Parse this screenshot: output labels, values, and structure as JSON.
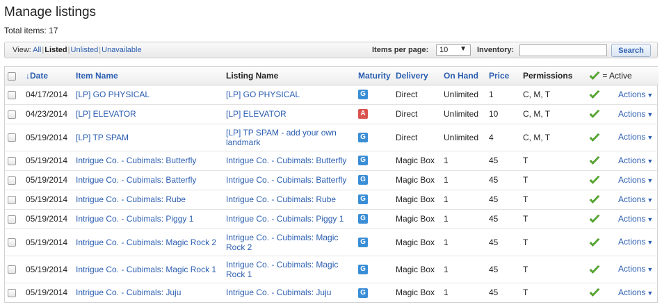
{
  "page": {
    "title": "Manage listings",
    "total_items": "Total items: 17"
  },
  "toolbar": {
    "view_label": "View:",
    "view_options": [
      "All",
      "Listed",
      "Unlisted",
      "Unavailable"
    ],
    "view_active": "Listed",
    "items_per_page_label": "Items per page:",
    "items_per_page_value": "10",
    "inventory_label": "Inventory:",
    "inventory_value": "",
    "search_label": "Search"
  },
  "colors": {
    "link": "#2a5db0",
    "badge_general": "#3a8ed6",
    "badge_adult": "#d9534f",
    "check_green": "#5cb030"
  },
  "table": {
    "headers": {
      "date": "↓Date",
      "item_name": "Item Name",
      "listing_name": "Listing Name",
      "maturity": "Maturity",
      "delivery": "Delivery",
      "on_hand": "On Hand",
      "price": "Price",
      "permissions": "Permissions",
      "active": "= Active"
    },
    "rows": [
      {
        "date": "04/17/2014",
        "item": "[LP] GO PHYSICAL",
        "listing": "[LP] GO PHYSICAL",
        "maturity": "G",
        "delivery": "Direct",
        "on_hand": "Unlimited",
        "price": "1",
        "permissions": "C, M, T",
        "actions": "Actions"
      },
      {
        "date": "04/23/2014",
        "item": "[LP] ELEVATOR",
        "listing": "[LP] ELEVATOR",
        "maturity": "A",
        "delivery": "Direct",
        "on_hand": "Unlimited",
        "price": "10",
        "permissions": "C, M, T",
        "actions": "Actions"
      },
      {
        "date": "05/19/2014",
        "item": "[LP] TP SPAM",
        "listing": "[LP] TP SPAM - add your own landmark",
        "maturity": "G",
        "delivery": "Direct",
        "on_hand": "Unlimited",
        "price": "4",
        "permissions": "C, M, T",
        "actions": "Actions"
      },
      {
        "date": "05/19/2014",
        "item": "Intrigue Co. - Cubimals: Butterfly",
        "listing": "Intrigue Co. - Cubimals: Butterfly",
        "maturity": "G",
        "delivery": "Magic Box",
        "on_hand": "1",
        "price": "45",
        "permissions": "T",
        "actions": "Actions"
      },
      {
        "date": "05/19/2014",
        "item": "Intrigue Co. - Cubimals: Batterfly",
        "listing": "Intrigue Co. - Cubimals: Batterfly",
        "maturity": "G",
        "delivery": "Magic Box",
        "on_hand": "1",
        "price": "45",
        "permissions": "T",
        "actions": "Actions"
      },
      {
        "date": "05/19/2014",
        "item": "Intrigue Co. - Cubimals: Rube",
        "listing": "Intrigue Co. - Cubimals: Rube",
        "maturity": "G",
        "delivery": "Magic Box",
        "on_hand": "1",
        "price": "45",
        "permissions": "T",
        "actions": "Actions"
      },
      {
        "date": "05/19/2014",
        "item": "Intrigue Co. - Cubimals: Piggy 1",
        "listing": "Intrigue Co. - Cubimals: Piggy 1",
        "maturity": "G",
        "delivery": "Magic Box",
        "on_hand": "1",
        "price": "45",
        "permissions": "T",
        "actions": "Actions"
      },
      {
        "date": "05/19/2014",
        "item": "Intrigue Co. - Cubimals: Magic Rock 2",
        "listing": "Intrigue Co. - Cubimals: Magic Rock 2",
        "maturity": "G",
        "delivery": "Magic Box",
        "on_hand": "1",
        "price": "45",
        "permissions": "T",
        "actions": "Actions"
      },
      {
        "date": "05/19/2014",
        "item": "Intrigue Co. - Cubimals: Magic Rock 1",
        "listing": "Intrigue Co. - Cubimals: Magic Rock 1",
        "maturity": "G",
        "delivery": "Magic Box",
        "on_hand": "1",
        "price": "45",
        "permissions": "T",
        "actions": "Actions"
      },
      {
        "date": "05/19/2014",
        "item": "Intrigue Co. - Cubimals: Juju",
        "listing": "Intrigue Co. - Cubimals: Juju",
        "maturity": "G",
        "delivery": "Magic Box",
        "on_hand": "1",
        "price": "45",
        "permissions": "T",
        "actions": "Actions"
      }
    ]
  }
}
